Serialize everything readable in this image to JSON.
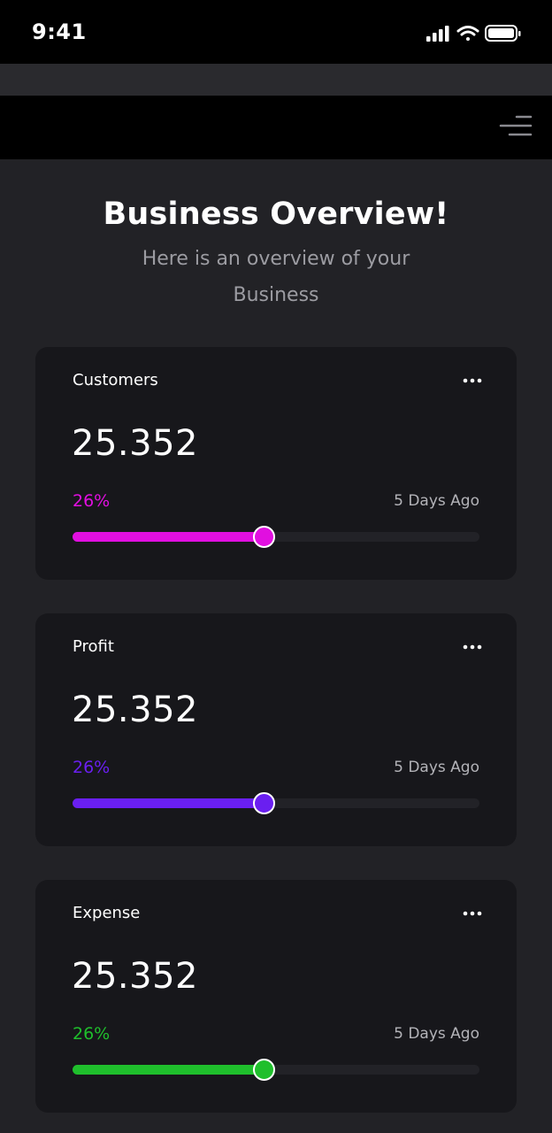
{
  "status_bar": {
    "time": "9:41",
    "icons": [
      "cellular-signal-icon",
      "wifi-icon",
      "battery-icon"
    ]
  },
  "nav": {
    "menu_icon": "menu-icon"
  },
  "hero": {
    "title": "Business Overview!",
    "subtitle": "Here is an overview of your Business"
  },
  "cards": [
    {
      "title": "Customers",
      "value": "25.352",
      "percent": "26%",
      "time": "5 Days Ago",
      "level": 0.47,
      "accent": "#e10fe0"
    },
    {
      "title": "Profit",
      "value": "25.352",
      "percent": "26%",
      "time": "5 Days Ago",
      "level": 0.47,
      "accent": "#6a1ff0"
    },
    {
      "title": "Expense",
      "value": "25.352",
      "percent": "26%",
      "time": "5 Days Ago",
      "level": 0.47,
      "accent": "#1fbf2c"
    }
  ]
}
